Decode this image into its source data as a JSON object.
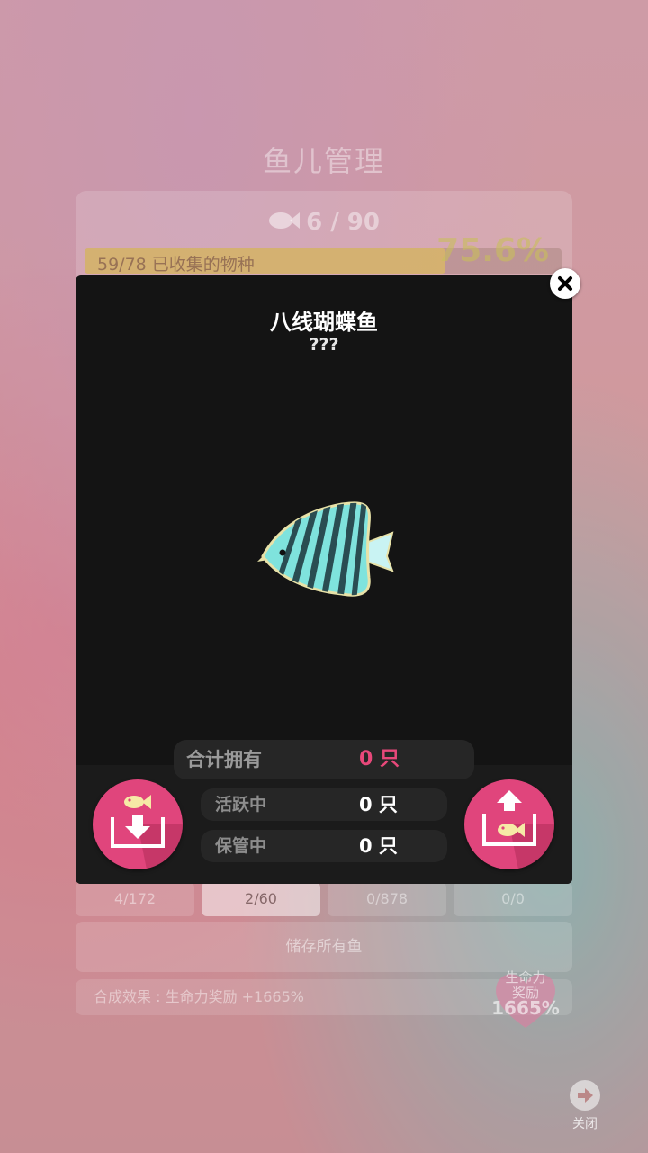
{
  "background": {
    "title": "鱼儿管理",
    "fish_count": "6 / 90",
    "collection_label": "59/78 已收集的物种",
    "collection_fraction": 0.756,
    "collection_percent": "75.6%",
    "tabs": [
      {
        "label": "4/172"
      },
      {
        "label": "2/60"
      },
      {
        "label": "0/878"
      },
      {
        "label": "0/0"
      }
    ],
    "store_all_label": "储存所有鱼",
    "effect_label": "合成效果 : 生命力奖励 +1665%",
    "bonus_badge": {
      "line1": "生命力",
      "line2": "奖励",
      "value": "1665%"
    },
    "close_label": "关闭"
  },
  "modal": {
    "fish_name": "八线瑚蝶鱼",
    "fish_subtitle": "???",
    "stats": {
      "total_label": "合计拥有",
      "total_value": "0 只",
      "active_label": "活跃中",
      "active_value": "0 只",
      "kept_label": "保管中",
      "kept_value": "0 只"
    }
  },
  "colors": {
    "accent_pink": "#e0457c",
    "modal_bg": "#141414",
    "total_value": "#e8487a",
    "fish_body": "#7fe3dd",
    "fish_stripes": "#2a4d52"
  },
  "icons": {
    "close": "close-icon",
    "store": "store-fish-icon",
    "release": "release-fish-icon"
  }
}
